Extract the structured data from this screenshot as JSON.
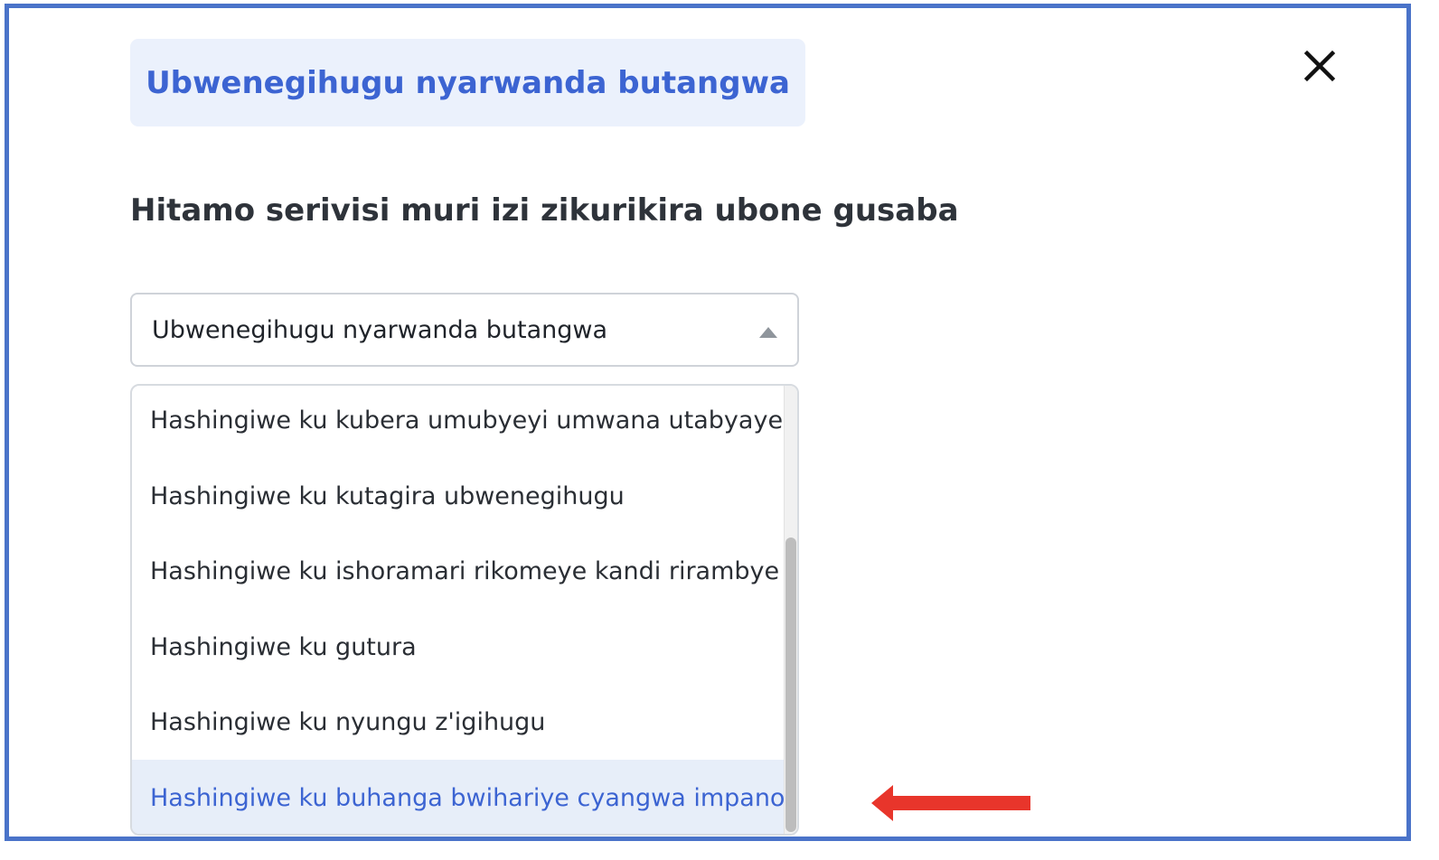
{
  "header": {
    "service_title": "Ubwenegihugu nyarwanda butangwa"
  },
  "main": {
    "heading": "Hitamo serivisi muri izi zikurikira ubone gusaba"
  },
  "select": {
    "current_value": "Ubwenegihugu nyarwanda butangwa",
    "options": [
      "Hashingiwe ku kubera umubyeyi umwana utabyaye",
      "Hashingiwe ku kutagira ubwenegihugu",
      "Hashingiwe ku ishoramari rikomeye kandi rirambye",
      "Hashingiwe ku gutura",
      "Hashingiwe ku nyungu z'igihugu",
      "Hashingiwe ku buhanga bwihariye cyangwa impano"
    ],
    "highlighted_option": "Hashingiwe ku buhanga bwihariye cyangwa impano"
  },
  "icons": {
    "close": "close-icon",
    "caret": "caret-up-icon",
    "annotation": "red-arrow-icon"
  },
  "colors": {
    "frame": "#4a73c9",
    "accent": "#3c64d2",
    "badge_bg": "#ebf1fc",
    "highlight_bg": "#e7eef9",
    "arrow": "#e8352b"
  }
}
